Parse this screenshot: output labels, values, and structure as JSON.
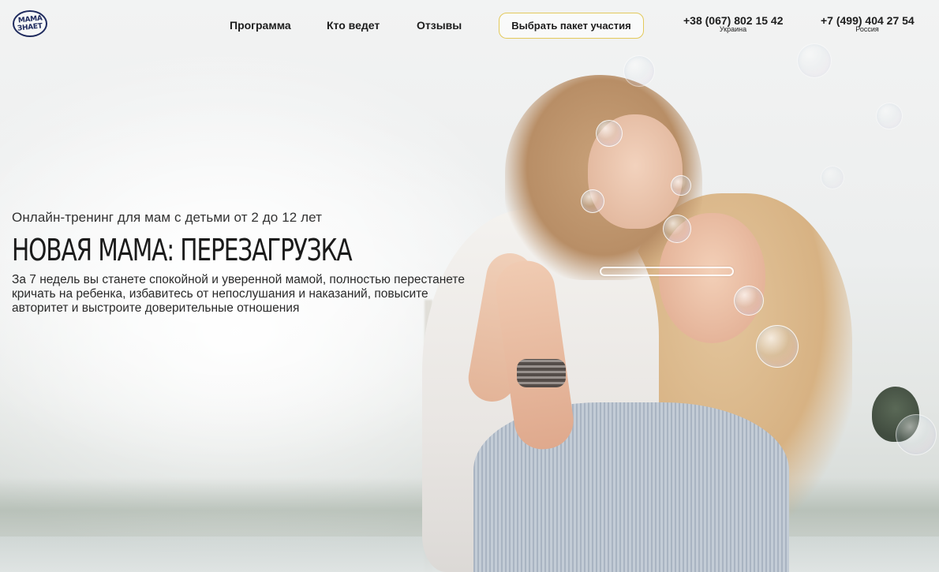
{
  "header": {
    "logo_lines": [
      "МАМА",
      "ЗНАЕТ"
    ],
    "nav": [
      {
        "label": "Программа"
      },
      {
        "label": "Кто ведет"
      },
      {
        "label": "Отзывы"
      }
    ],
    "cta_label": "Выбрать пакет участия",
    "phones": [
      {
        "number": "+38 (067) 802 15 42",
        "country": "Украина"
      },
      {
        "number": "+7 (499) 404 27 54",
        "country": "Россия"
      }
    ]
  },
  "hero": {
    "subtitle": "Онлайн-тренинг для мам с детьми от 2 до 12 лет",
    "title": "НОВАЯ МАМА: ПЕРЕЗАГРУЗКА",
    "description": "За 7 недель вы станете спокойной и уверенной мамой, полностью перестанете кричать на ребенка, избавитесь от непослушания и наказаний, повысите авторитет и выстроите доверительные отношения"
  },
  "colors": {
    "logo": "#1f2b5e",
    "cta_border": "#e3c95a",
    "text": "#1d1d1d"
  }
}
